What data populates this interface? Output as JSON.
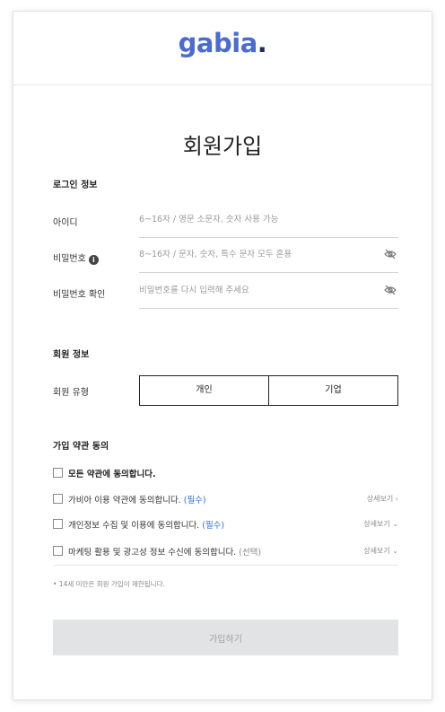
{
  "logo": {
    "text": "gabia",
    "dot": "."
  },
  "title": "회원가입",
  "login_section": {
    "heading": "로그인 정보",
    "id_label": "아이디",
    "id_placeholder": "6~16자 / 영문 소문자, 숫자 사용 가능",
    "pw_label": "비밀번호",
    "pw_placeholder": "8~16자 / 문자, 숫자, 특수 문자 모두 혼용",
    "pw_confirm_label": "비밀번호 확인",
    "pw_confirm_placeholder": "비밀번호를 다시 입력해 주세요"
  },
  "member_section": {
    "heading": "회원 정보",
    "type_label": "회원 유형",
    "type_options": [
      "개인",
      "기업"
    ]
  },
  "terms_section": {
    "heading": "가입 약관 동의",
    "agree_all": "모든 약관에 동의합니다.",
    "items": [
      {
        "text": "가비아 이용 약관에 동의합니다.",
        "tag": "(필수)",
        "detail": "상세보기 ›"
      },
      {
        "text": "개인정보 수집 및 이용에 동의합니다.",
        "tag": "(필수)",
        "detail": "상세보기 ⌄"
      },
      {
        "text": "마케팅 활용 및 광고성 정보 수신에 동의합니다.",
        "tag": "(선택)",
        "detail": "상세보기 ⌄"
      }
    ],
    "note": "• 14세 미만은 회원 가입이 제한됩니다."
  },
  "submit_label": "가입하기",
  "icons": {
    "info": "info-icon",
    "eye_off": "eye-off-icon"
  }
}
